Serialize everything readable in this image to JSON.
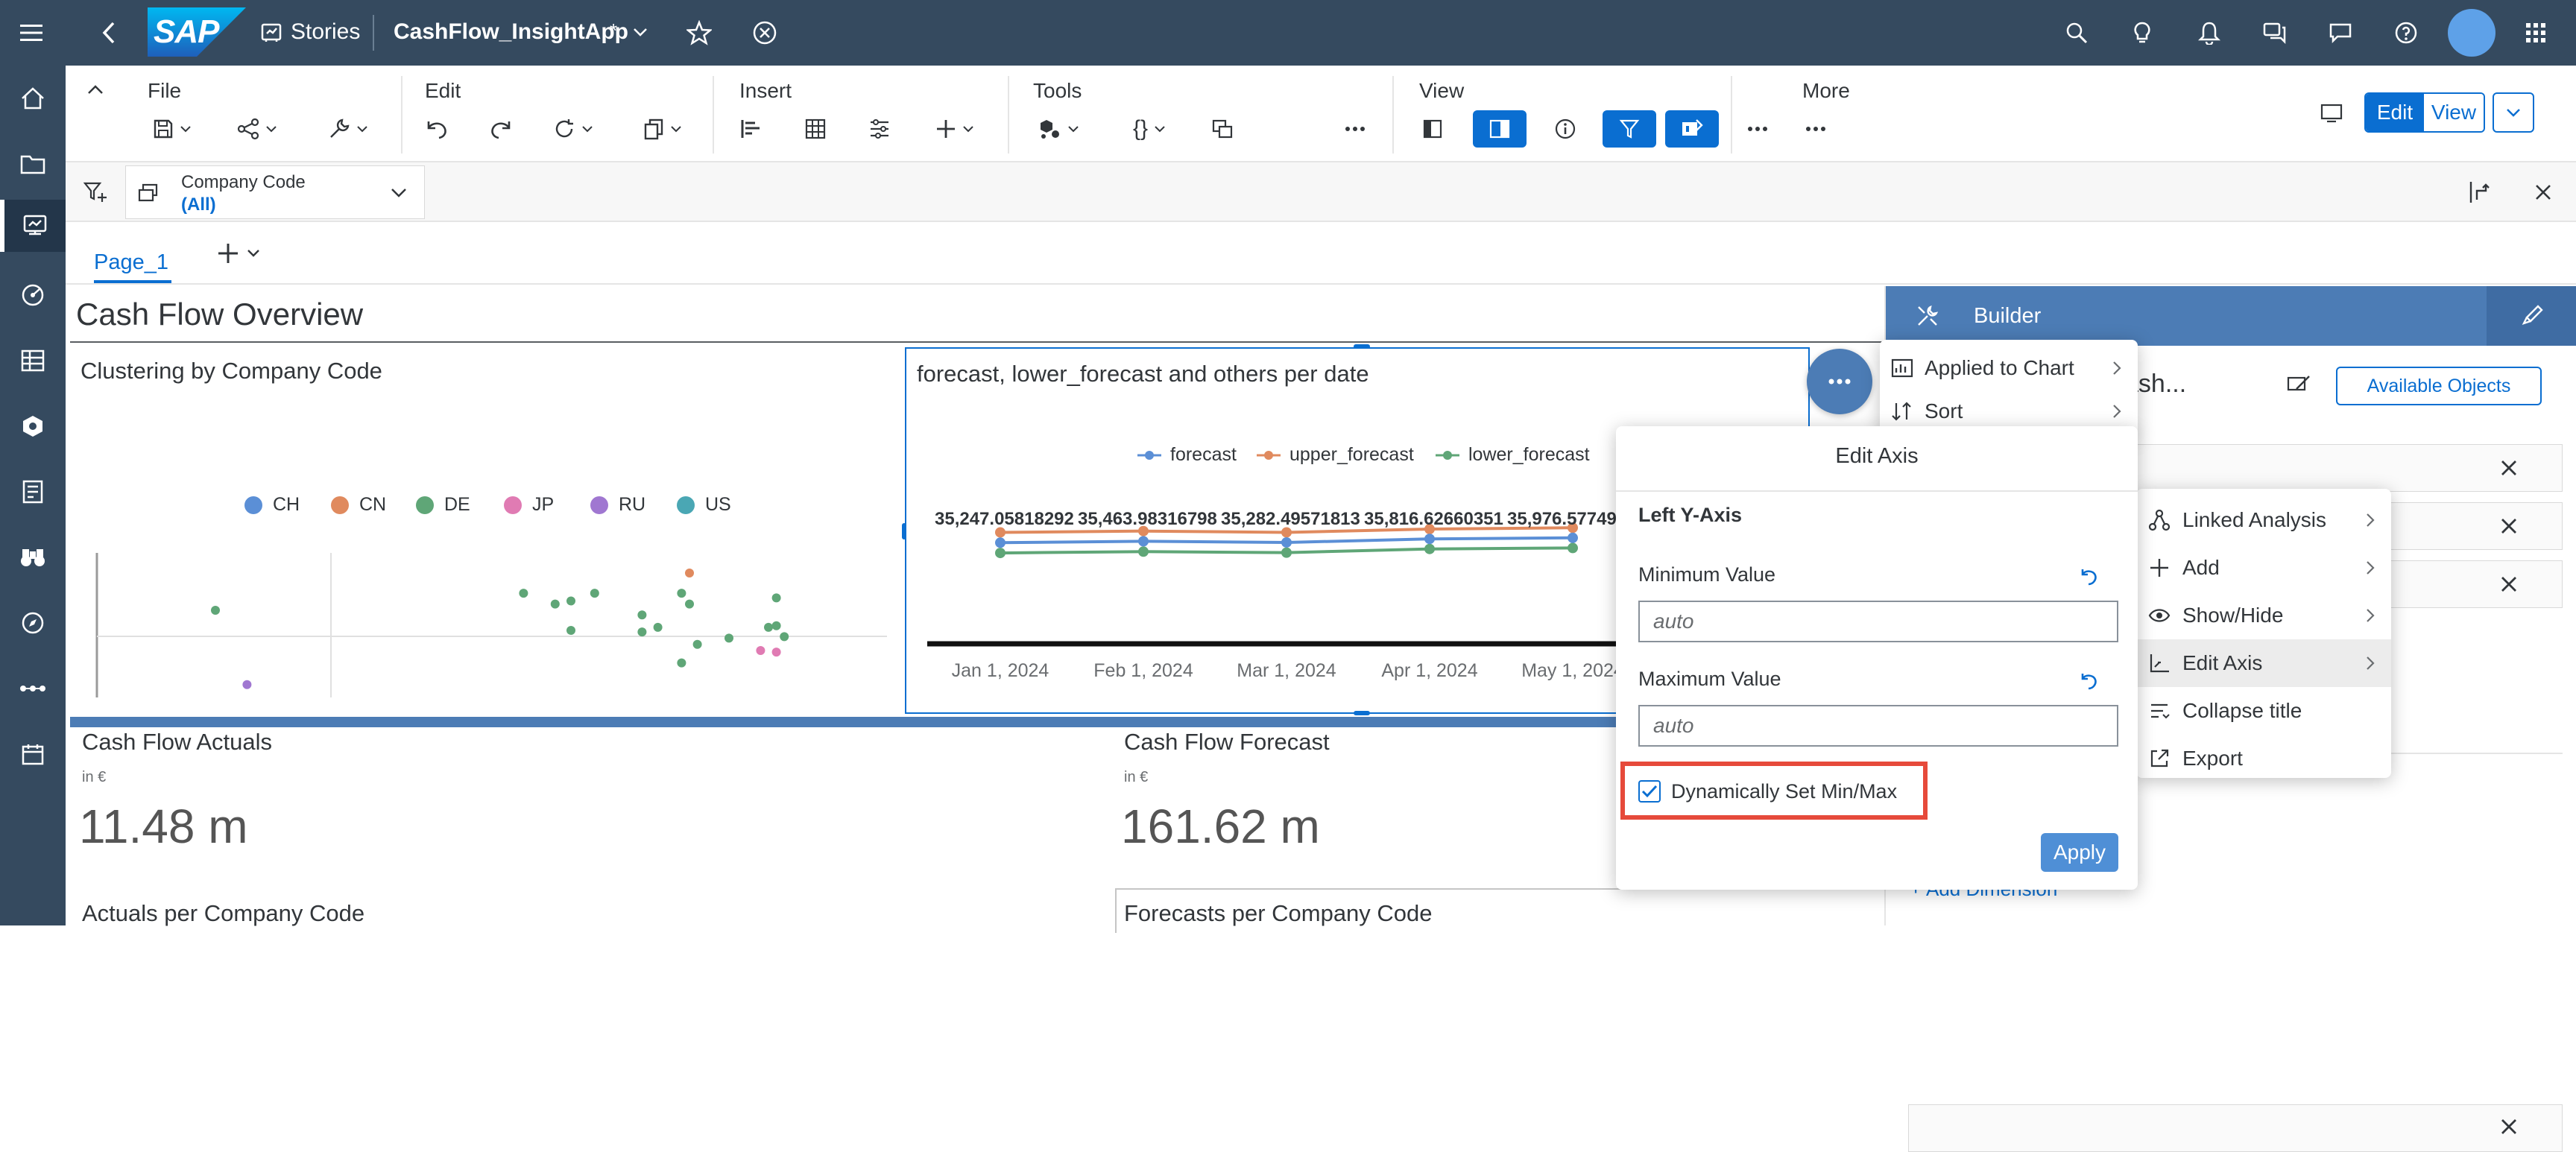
{
  "shell": {
    "logo": "SAP",
    "stories_label": "Stories",
    "story_name": "CashFlow_InsightApp",
    "unsaved_marker": "*"
  },
  "toolbar": {
    "file": "File",
    "edit": "Edit",
    "insert": "Insert",
    "tools": "Tools",
    "view": "View",
    "more": "More",
    "edit_mode": "Edit",
    "view_mode": "View"
  },
  "filterbar": {
    "filter_label": "Company Code",
    "filter_value": "(All)"
  },
  "pages": {
    "tab": "Page_1"
  },
  "canvas": {
    "page_title": "Cash Flow Overview",
    "clustering_title": "Clustering by Company Code",
    "forecast_title": "forecast, lower_forecast and others per date",
    "actuals_title": "Cash Flow Actuals",
    "actuals_unit": "in €",
    "actuals_value": "11.48 m",
    "forecast_kpi_title": "Cash Flow Forecast",
    "forecast_kpi_unit": "in €",
    "forecast_kpi_value": "161.62 m",
    "actuals_per_cc": "Actuals per Company Code",
    "forecasts_per_cc": "Forecasts per Company Code"
  },
  "builder": {
    "title": "Builder",
    "chart_name_partial": "ash...",
    "available_objects": "Available Objects",
    "add_dimension": "Add Dimension"
  },
  "context_menu_left": {
    "items": [
      "Applied to Chart",
      "Sort"
    ]
  },
  "context_menu_right": {
    "items": [
      "Linked Analysis",
      "Add",
      "Show/Hide",
      "Edit Axis",
      "Collapse title",
      "Export"
    ]
  },
  "edit_axis": {
    "title": "Edit Axis",
    "section": "Left Y-Axis",
    "min_label": "Minimum Value",
    "min_placeholder": "auto",
    "max_label": "Maximum Value",
    "max_placeholder": "auto",
    "dynamic_label": "Dynamically Set Min/Max",
    "dynamic_checked": true,
    "apply": "Apply"
  },
  "colors": {
    "shell": "#354a5f",
    "accent": "#0a6ed1",
    "highlight": "#e64a3b"
  },
  "chart_data": [
    {
      "type": "scatter",
      "title": "Clustering by Company Code",
      "legend": [
        "CH",
        "CN",
        "DE",
        "JP",
        "RU",
        "US"
      ],
      "legend_position": "top",
      "series_colors": {
        "CH": "#5b8fd6",
        "CN": "#e08a5e",
        "DE": "#5fa677",
        "JP": "#e07bb3",
        "RU": "#a077d1",
        "US": "#4aa7b4"
      },
      "grid": true,
      "points": [
        {
          "series": "DE",
          "x": 0.15,
          "y": 0.63
        },
        {
          "series": "RU",
          "x": 0.19,
          "y": 0.15
        },
        {
          "series": "DE",
          "x": 0.54,
          "y": 0.74
        },
        {
          "series": "DE",
          "x": 0.58,
          "y": 0.67
        },
        {
          "series": "DE",
          "x": 0.6,
          "y": 0.69
        },
        {
          "series": "DE",
          "x": 0.63,
          "y": 0.74
        },
        {
          "series": "DE",
          "x": 0.6,
          "y": 0.5
        },
        {
          "series": "DE",
          "x": 0.69,
          "y": 0.6
        },
        {
          "series": "DE",
          "x": 0.69,
          "y": 0.49
        },
        {
          "series": "DE",
          "x": 0.71,
          "y": 0.52
        },
        {
          "series": "CN",
          "x": 0.75,
          "y": 0.87
        },
        {
          "series": "DE",
          "x": 0.74,
          "y": 0.74
        },
        {
          "series": "DE",
          "x": 0.75,
          "y": 0.67
        },
        {
          "series": "DE",
          "x": 0.76,
          "y": 0.41
        },
        {
          "series": "DE",
          "x": 0.74,
          "y": 0.29
        },
        {
          "series": "DE",
          "x": 0.8,
          "y": 0.45
        },
        {
          "series": "DE",
          "x": 0.87,
          "y": 0.46
        },
        {
          "series": "DE",
          "x": 0.86,
          "y": 0.71
        },
        {
          "series": "DE",
          "x": 0.85,
          "y": 0.52
        },
        {
          "series": "DE",
          "x": 0.86,
          "y": 0.53
        },
        {
          "series": "JP",
          "x": 0.84,
          "y": 0.37
        },
        {
          "series": "JP",
          "x": 0.86,
          "y": 0.36
        }
      ]
    },
    {
      "type": "line",
      "title": "forecast, lower_forecast and others per date",
      "legend_position": "top",
      "categories": [
        "Jan 1, 2024",
        "Feb 1, 2024",
        "Mar 1, 2024",
        "Apr 1, 2024",
        "May 1, 2024"
      ],
      "data_labels": [
        "35,247.05818292",
        "35,463.98316798",
        "35,282.49571813",
        "35,816.62660351",
        "35,976.57749"
      ],
      "series": [
        {
          "name": "forecast",
          "color": "#5b8fd6",
          "values": [
            35247.06,
            35463.98,
            35282.5,
            35816.63,
            35976.58
          ]
        },
        {
          "name": "upper_forecast",
          "color": "#e08a5e",
          "values": [
            36800,
            37000,
            36800,
            37300,
            37500
          ]
        },
        {
          "name": "lower_forecast",
          "color": "#5fa677",
          "values": [
            33700,
            33900,
            33750,
            34300,
            34450
          ]
        }
      ]
    }
  ]
}
